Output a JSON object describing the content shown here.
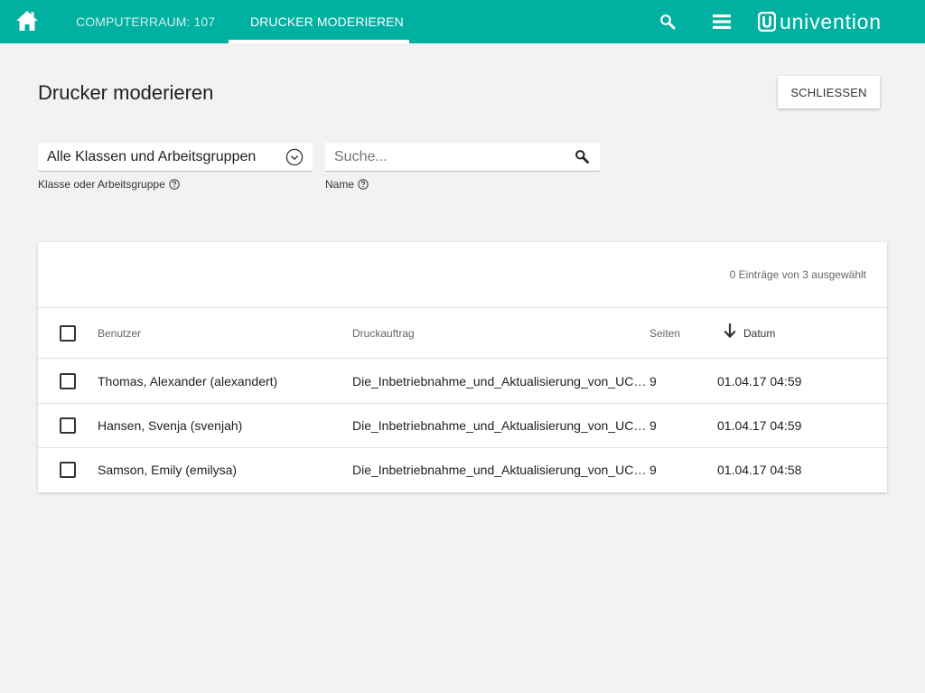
{
  "header": {
    "tabs": [
      {
        "label": "COMPUTERRAUM: 107",
        "active": false
      },
      {
        "label": "DRUCKER MODERIEREN",
        "active": true
      }
    ],
    "logo_text": "univention",
    "icons": [
      "home-icon",
      "search-icon",
      "hamburger-menu-icon",
      "univention-logo-icon"
    ],
    "accent_color": "#00b0a1"
  },
  "page": {
    "title": "Drucker moderieren",
    "close_label": "SCHLIESSEN"
  },
  "filters": {
    "class_select": {
      "value": "Alle Klassen und Arbeitsgruppen",
      "label": "Klasse oder Arbeitsgruppe"
    },
    "name_search": {
      "placeholder": "Suche...",
      "value": "",
      "label": "Name"
    }
  },
  "grid": {
    "selection_status": "0 Einträge von 3 ausgewählt",
    "columns": {
      "user": "Benutzer",
      "job": "Druckauftrag",
      "pages": "Seiten",
      "date": "Datum"
    },
    "sort": {
      "column": "date",
      "direction": "descending"
    },
    "rows": [
      {
        "user": "Thomas, Alexander (alexandert)",
        "job": "Die_Inbetriebnahme_und_Aktualisierung_von_UCS_…",
        "pages": "9",
        "date": "01.04.17 04:59"
      },
      {
        "user": "Hansen, Svenja (svenjah)",
        "job": "Die_Inbetriebnahme_und_Aktualisierung_von_UCS_…",
        "pages": "9",
        "date": "01.04.17 04:59"
      },
      {
        "user": "Samson, Emily (emilysa)",
        "job": "Die_Inbetriebnahme_und_Aktualisierung_von_UCS_…",
        "pages": "9",
        "date": "01.04.17 04:58"
      }
    ]
  }
}
